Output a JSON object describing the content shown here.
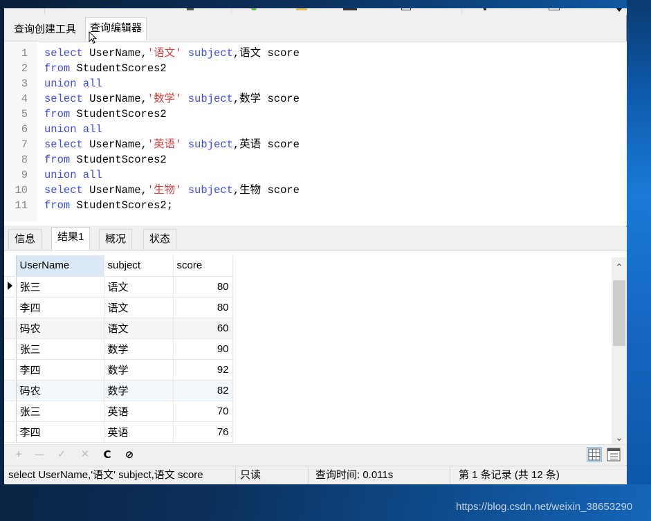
{
  "window": {
    "outer_tabs": [
      {
        "label": "查询创建工具",
        "active": false
      },
      {
        "label": "查询编辑器",
        "active": true
      }
    ]
  },
  "editor": {
    "lines": [
      {
        "n": "1",
        "parts": [
          {
            "t": "kw",
            "v": "select "
          },
          {
            "t": "plain",
            "v": "UserName,"
          },
          {
            "t": "str",
            "v": "'语文'"
          },
          {
            "t": "kw",
            "v": " subject"
          },
          {
            "t": "plain",
            "v": ",语文 score"
          }
        ]
      },
      {
        "n": "2",
        "parts": [
          {
            "t": "kw",
            "v": "from "
          },
          {
            "t": "plain",
            "v": "StudentScores2"
          }
        ]
      },
      {
        "n": "3",
        "parts": [
          {
            "t": "kw",
            "v": "union all"
          }
        ]
      },
      {
        "n": "4",
        "parts": [
          {
            "t": "kw",
            "v": "select "
          },
          {
            "t": "plain",
            "v": "UserName,"
          },
          {
            "t": "str",
            "v": "'数学'"
          },
          {
            "t": "kw",
            "v": " subject"
          },
          {
            "t": "plain",
            "v": ",数学 score"
          }
        ]
      },
      {
        "n": "5",
        "parts": [
          {
            "t": "kw",
            "v": "from "
          },
          {
            "t": "plain",
            "v": "StudentScores2"
          }
        ]
      },
      {
        "n": "6",
        "parts": [
          {
            "t": "kw",
            "v": "union all"
          }
        ]
      },
      {
        "n": "7",
        "parts": [
          {
            "t": "kw",
            "v": "select "
          },
          {
            "t": "plain",
            "v": "UserName,"
          },
          {
            "t": "str",
            "v": "'英语'"
          },
          {
            "t": "kw",
            "v": " subject"
          },
          {
            "t": "plain",
            "v": ",英语 score"
          }
        ]
      },
      {
        "n": "8",
        "parts": [
          {
            "t": "kw",
            "v": "from "
          },
          {
            "t": "plain",
            "v": "StudentScores2"
          }
        ]
      },
      {
        "n": "9",
        "parts": [
          {
            "t": "kw",
            "v": "union all"
          }
        ]
      },
      {
        "n": "10",
        "parts": [
          {
            "t": "kw",
            "v": "select "
          },
          {
            "t": "plain",
            "v": "UserName,"
          },
          {
            "t": "str",
            "v": "'生物'"
          },
          {
            "t": "kw",
            "v": " subject"
          },
          {
            "t": "plain",
            "v": ",生物 score"
          }
        ]
      },
      {
        "n": "11",
        "parts": [
          {
            "t": "kw",
            "v": "from "
          },
          {
            "t": "plain",
            "v": "StudentScores2;"
          }
        ]
      }
    ]
  },
  "result_tabs": [
    {
      "label": "信息",
      "active": false
    },
    {
      "label": "结果1",
      "active": true
    },
    {
      "label": "概况",
      "active": false
    },
    {
      "label": "状态",
      "active": false
    }
  ],
  "grid": {
    "columns": [
      "UserName",
      "subject",
      "score"
    ],
    "rows": [
      [
        "张三",
        "语文",
        "80"
      ],
      [
        "李四",
        "语文",
        "80"
      ],
      [
        "码农",
        "语文",
        "60"
      ],
      [
        "张三",
        "数学",
        "90"
      ],
      [
        "李四",
        "数学",
        "92"
      ],
      [
        "码农",
        "数学",
        "82"
      ],
      [
        "张三",
        "英语",
        "70"
      ],
      [
        "李四",
        "英语",
        "76"
      ]
    ]
  },
  "bottom_toolbar": {
    "buttons": [
      {
        "name": "add-record",
        "glyph": "+",
        "enabled": false
      },
      {
        "name": "delete-record",
        "glyph": "—",
        "enabled": false
      },
      {
        "name": "apply-changes",
        "glyph": "✓",
        "enabled": false
      },
      {
        "name": "discard-changes",
        "glyph": "✕",
        "enabled": false
      },
      {
        "name": "refresh",
        "glyph": "C",
        "enabled": true
      },
      {
        "name": "stop",
        "glyph": "⊘",
        "enabled": true
      }
    ]
  },
  "statusbar": {
    "sql": "select UserName,'语文' subject,语文 score",
    "mode": "只读",
    "query_time": "查询时间: 0.011s",
    "record": "第 1 条记录 (共 12 条)"
  },
  "watermark": "https://blog.csdn.net/weixin_38653290"
}
